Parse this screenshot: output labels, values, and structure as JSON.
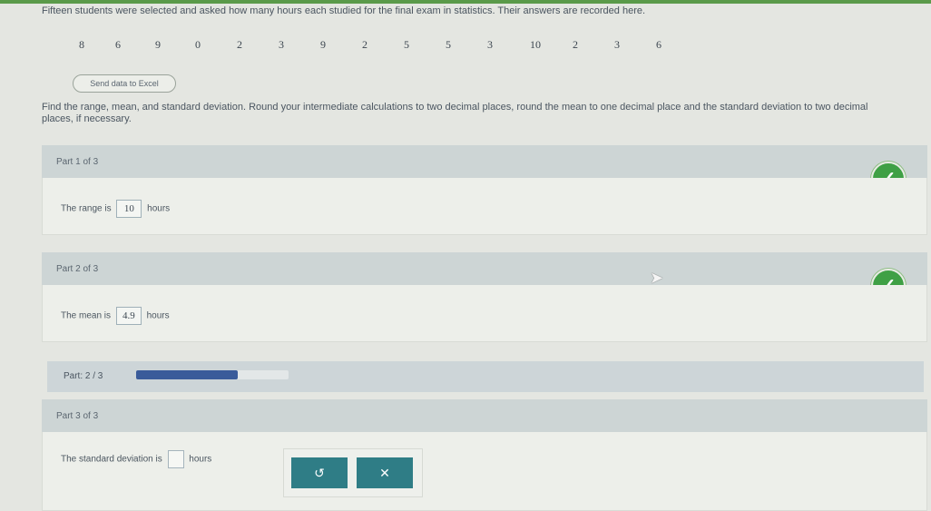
{
  "problem": {
    "prompt": "Fifteen students were selected and asked how many hours each studied for the final exam in statistics. Their answers are recorded here.",
    "values": [
      "8",
      "6",
      "9",
      "0",
      "2",
      "3",
      "9",
      "2",
      "5",
      "5",
      "3",
      "10",
      "2",
      "3",
      "6"
    ],
    "excel_button": "Send data to Excel",
    "instructions": "Find the range, mean, and standard deviation. Round your intermediate calculations to two decimal places, round the mean to one decimal place and the standard deviation to two decimal places, if necessary."
  },
  "parts": [
    {
      "title": "Part 1 of 3",
      "prefix": "The range is",
      "value": "10",
      "suffix": "hours",
      "check": "✓"
    },
    {
      "title": "Part 2 of 3",
      "prefix": "The mean is",
      "value": "4.9",
      "suffix": "hours",
      "check": "✓"
    },
    {
      "title": "Part 3 of 3",
      "prefix": "The standard deviation is",
      "value": "",
      "suffix": "hours"
    }
  ],
  "progress": {
    "label": "Part: 2 / 3",
    "fraction": 0.667,
    "color": "#3a5b9a"
  },
  "actions": {
    "undo_icon": "↺",
    "clear_icon": "✕"
  },
  "colors": {
    "check": "#3fa045",
    "button": "#2f7d86",
    "header": "#cdd5d5"
  }
}
